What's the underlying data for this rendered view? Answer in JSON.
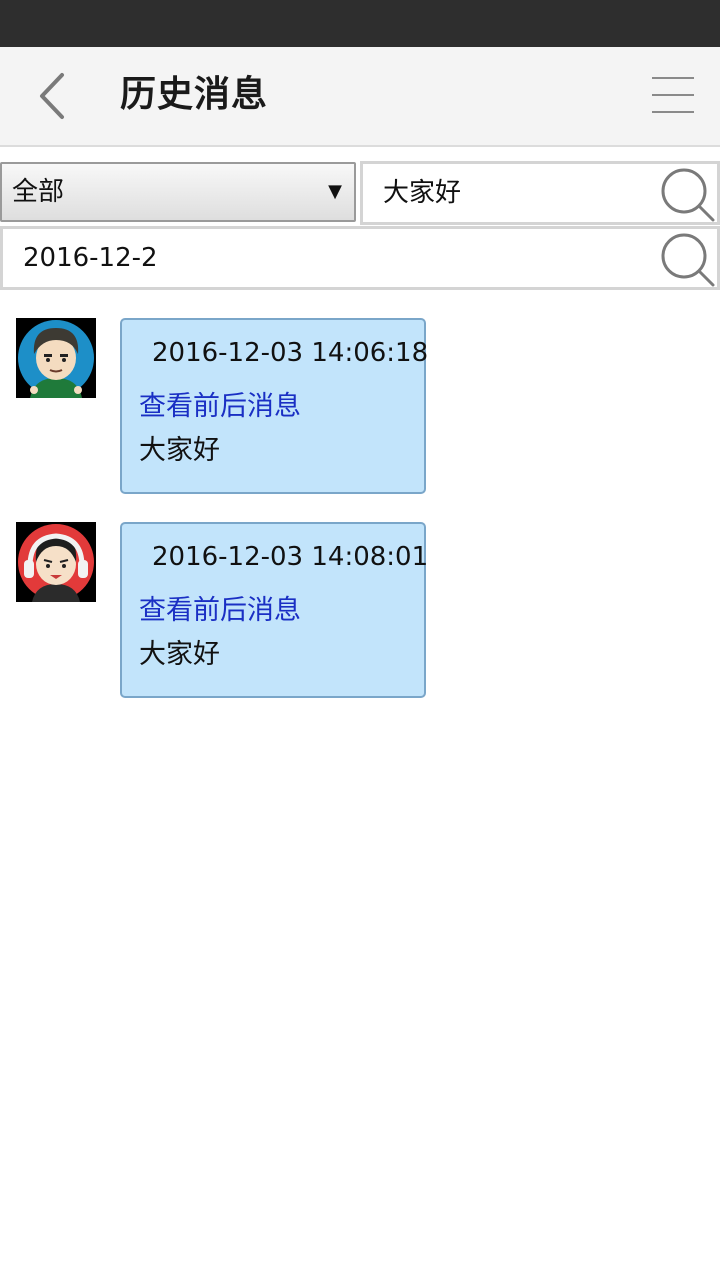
{
  "header": {
    "title": "历史消息",
    "back_icon": "chevron-left-icon",
    "menu_icon": "hamburger-menu-icon"
  },
  "filters": {
    "category_selected": "全部",
    "keyword_value": "大家好",
    "date_value": "2016-12-2",
    "search_icon": "magnifier-icon"
  },
  "messages": [
    {
      "avatar": "avatar-boy-blue-icon",
      "time": "2016-12-03 14:06:18",
      "link_label": "查看前后消息",
      "text": "大家好"
    },
    {
      "avatar": "avatar-girl-red-headphones-icon",
      "time": "2016-12-03 14:08:01",
      "link_label": "查看前后消息",
      "text": "大家好"
    }
  ],
  "colors": {
    "status_bar": "#2e2e2e",
    "title_bar": "#f4f4f4",
    "bubble_bg": "#c2e4fb",
    "bubble_border": "#7aa6c9",
    "link": "#1a2fc4"
  }
}
